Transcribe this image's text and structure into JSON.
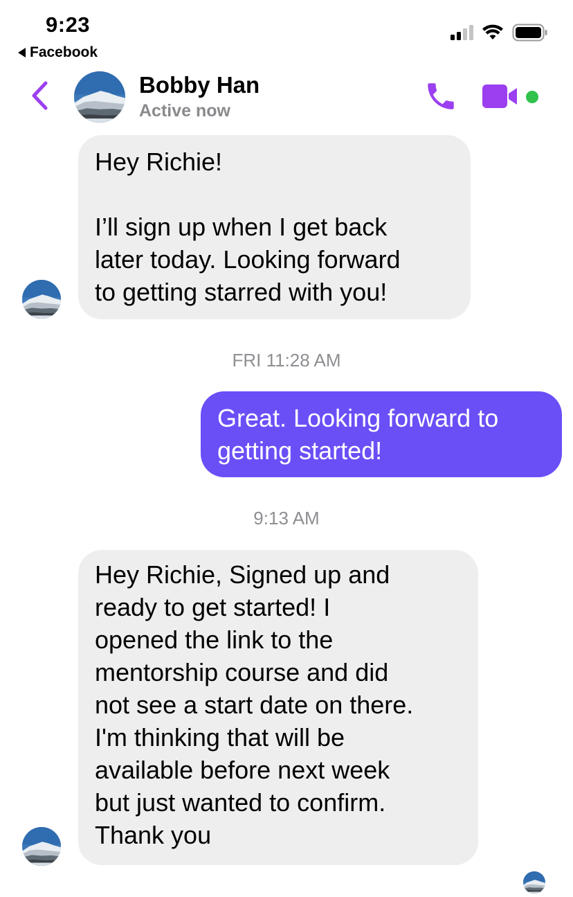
{
  "status_bar": {
    "time": "9:23",
    "back_app": "Facebook",
    "icons": [
      "cellular-signal-icon",
      "wifi-icon",
      "battery-icon"
    ]
  },
  "header": {
    "contact_name": "Bobby Han",
    "presence": "Active now",
    "actions": [
      "back-chevron-icon",
      "phone-call-icon",
      "video-call-icon"
    ],
    "accent_color": "#9b3ff0",
    "online_color": "#31c24d"
  },
  "conversation": {
    "messages": [
      {
        "direction": "incoming",
        "text": "Hey Richie!\n\nI’ll sign up when I get back\nlater today. Looking forward\nto getting starred with you!"
      },
      {
        "direction": "outgoing",
        "text": "Great. Looking forward to\ngetting started!"
      },
      {
        "direction": "incoming",
        "text": "Hey Richie, Signed up and\nready to get started! I\nopened the link to the\nmentorship course and did\nnot see a start date on there.\nI'm thinking that will be\navailable before next week\nbut just wanted to confirm.\nThank you"
      }
    ],
    "timestamps": [
      "FRI 11:28 AM",
      "9:13 AM"
    ],
    "incoming_bubble_color": "#eeeeee",
    "outgoing_bubble_color": "#6a4ff7"
  }
}
